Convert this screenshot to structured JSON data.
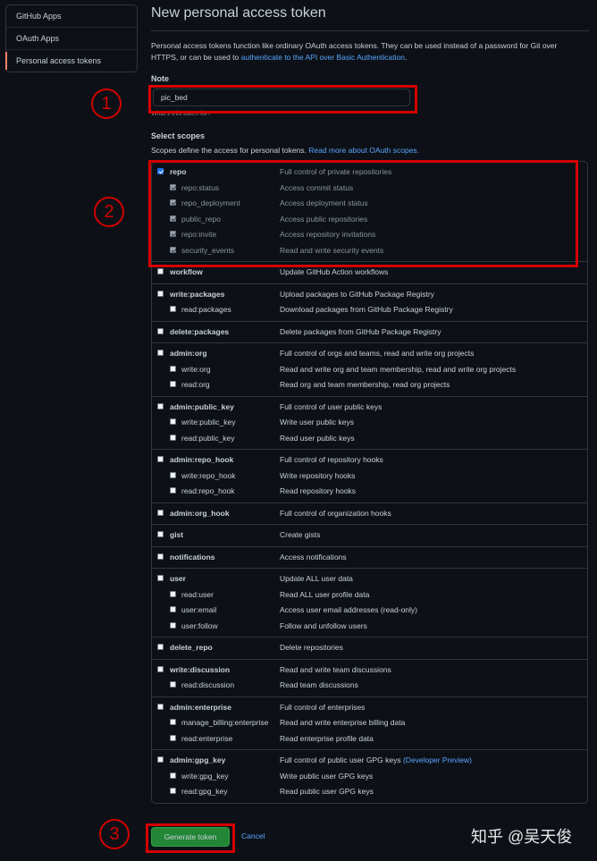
{
  "sidebar": {
    "items": [
      {
        "label": "GitHub Apps"
      },
      {
        "label": "OAuth Apps"
      },
      {
        "label": "Personal access tokens"
      }
    ]
  },
  "page": {
    "title": "New personal access token",
    "intro_text": "Personal access tokens function like ordinary OAuth access tokens. They can be used instead of a password for Git over HTTPS, or can be used to ",
    "intro_link": "authenticate to the API over Basic Authentication",
    "intro_end": "."
  },
  "note": {
    "label": "Note",
    "value": "pic_bed",
    "hint": "What's this token for?"
  },
  "scopes": {
    "label": "Select scopes",
    "desc": "Scopes define the access for personal tokens. ",
    "desc_link": "Read more about OAuth scopes.",
    "groups": [
      {
        "key": "repo",
        "items": [
          {
            "name": "repo",
            "desc": "Full control of private repositories",
            "checked": true
          },
          {
            "name": "repo:status",
            "desc": "Access commit status",
            "checked": true
          },
          {
            "name": "repo_deployment",
            "desc": "Access deployment status",
            "checked": true
          },
          {
            "name": "public_repo",
            "desc": "Access public repositories",
            "checked": true
          },
          {
            "name": "repo:invite",
            "desc": "Access repository invitations",
            "checked": true
          },
          {
            "name": "security_events",
            "desc": "Read and write security events",
            "checked": true
          }
        ]
      },
      {
        "key": "workflow",
        "items": [
          {
            "name": "workflow",
            "desc": "Update GitHub Action workflows"
          }
        ]
      },
      {
        "key": "write-packages",
        "items": [
          {
            "name": "write:packages",
            "desc": "Upload packages to GitHub Package Registry"
          },
          {
            "name": "read:packages",
            "desc": "Download packages from GitHub Package Registry"
          }
        ]
      },
      {
        "key": "delete-packages",
        "items": [
          {
            "name": "delete:packages",
            "desc": "Delete packages from GitHub Package Registry"
          }
        ]
      },
      {
        "key": "admin-org",
        "items": [
          {
            "name": "admin:org",
            "desc": "Full control of orgs and teams, read and write org projects"
          },
          {
            "name": "write:org",
            "desc": "Read and write org and team membership, read and write org projects"
          },
          {
            "name": "read:org",
            "desc": "Read org and team membership, read org projects"
          }
        ]
      },
      {
        "key": "admin-public-key",
        "items": [
          {
            "name": "admin:public_key",
            "desc": "Full control of user public keys"
          },
          {
            "name": "write:public_key",
            "desc": "Write user public keys"
          },
          {
            "name": "read:public_key",
            "desc": "Read user public keys"
          }
        ]
      },
      {
        "key": "admin-repo-hook",
        "items": [
          {
            "name": "admin:repo_hook",
            "desc": "Full control of repository hooks"
          },
          {
            "name": "write:repo_hook",
            "desc": "Write repository hooks"
          },
          {
            "name": "read:repo_hook",
            "desc": "Read repository hooks"
          }
        ]
      },
      {
        "key": "admin-org-hook",
        "items": [
          {
            "name": "admin:org_hook",
            "desc": "Full control of organization hooks"
          }
        ]
      },
      {
        "key": "gist",
        "items": [
          {
            "name": "gist",
            "desc": "Create gists"
          }
        ]
      },
      {
        "key": "notifications",
        "items": [
          {
            "name": "notifications",
            "desc": "Access notifications"
          }
        ]
      },
      {
        "key": "user",
        "items": [
          {
            "name": "user",
            "desc": "Update ALL user data"
          },
          {
            "name": "read:user",
            "desc": "Read ALL user profile data"
          },
          {
            "name": "user:email",
            "desc": "Access user email addresses (read-only)"
          },
          {
            "name": "user:follow",
            "desc": "Follow and unfollow users"
          }
        ]
      },
      {
        "key": "delete-repo",
        "items": [
          {
            "name": "delete_repo",
            "desc": "Delete repositories"
          }
        ]
      },
      {
        "key": "write-discussion",
        "items": [
          {
            "name": "write:discussion",
            "desc": "Read and write team discussions"
          },
          {
            "name": "read:discussion",
            "desc": "Read team discussions"
          }
        ]
      },
      {
        "key": "admin-enterprise",
        "items": [
          {
            "name": "admin:enterprise",
            "desc": "Full control of enterprises"
          },
          {
            "name": "manage_billing:enterprise",
            "desc": "Read and write enterprise billing data"
          },
          {
            "name": "read:enterprise",
            "desc": "Read enterprise profile data"
          }
        ]
      },
      {
        "key": "admin-gpg-key",
        "items": [
          {
            "name": "admin:gpg_key",
            "desc": "Full control of public user GPG keys",
            "preview": "(Developer Preview)"
          },
          {
            "name": "write:gpg_key",
            "desc": "Write public user GPG keys"
          },
          {
            "name": "read:gpg_key",
            "desc": "Read public user GPG keys"
          }
        ]
      }
    ]
  },
  "actions": {
    "generate": "Generate token",
    "cancel": "Cancel"
  },
  "annotations": {
    "one": "1",
    "two": "2",
    "three": "3",
    "color": "#d40000"
  },
  "watermark": "知乎 @吴天俊",
  "colors": {
    "background": "#0d1117",
    "link": "#58a6ff",
    "primary_button": "#238636",
    "active_marker": "#f78166"
  }
}
